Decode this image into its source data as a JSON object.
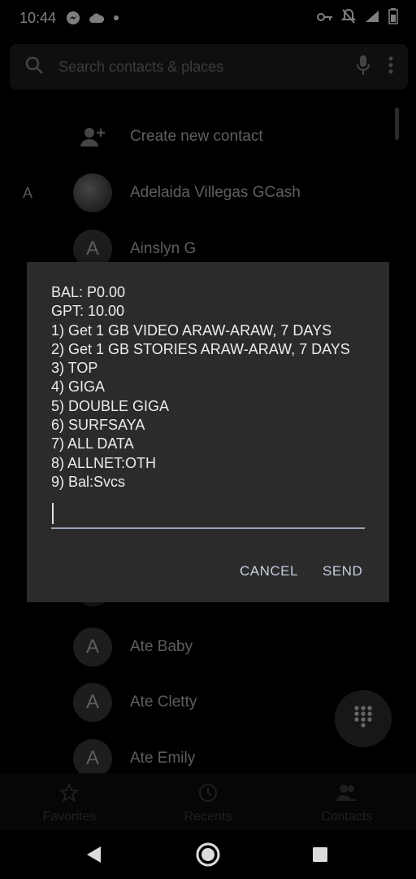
{
  "status_bar": {
    "time": "10:44",
    "left_icons": [
      "messenger-icon",
      "cloud-icon",
      "dot-icon"
    ],
    "right_icons": [
      "vpn-key-icon",
      "bell-off-icon",
      "signal-icon",
      "battery-icon"
    ]
  },
  "search": {
    "placeholder": "Search contacts & places"
  },
  "contacts": {
    "create_label": "Create new contact",
    "section_letter": "A",
    "items": [
      {
        "name": "Adelaida Villegas GCash",
        "initial": ""
      },
      {
        "name": "Ainslyn G",
        "initial": "A"
      },
      {
        "name": "Ate Baby",
        "initial": "A"
      },
      {
        "name": "Ate Cletty",
        "initial": "A"
      },
      {
        "name": "Ate Emily",
        "initial": "A"
      }
    ]
  },
  "dialog": {
    "lines": [
      "BAL: P0.00",
      "GPT: 10.00",
      "1) Get 1 GB VIDEO ARAW-ARAW, 7 DAYS",
      "2) Get 1 GB STORIES ARAW-ARAW, 7 DAYS",
      "3) TOP",
      "4) GIGA",
      "5) DOUBLE GIGA",
      "6) SURFSAYA",
      "7) ALL DATA",
      "8) ALLNET:OTH",
      "9) Bal:Svcs"
    ],
    "input_value": "",
    "cancel_label": "CANCEL",
    "send_label": "SEND"
  },
  "bottom_nav": {
    "favorites": "Favorites",
    "recents": "Recents",
    "contacts": "Contacts"
  }
}
